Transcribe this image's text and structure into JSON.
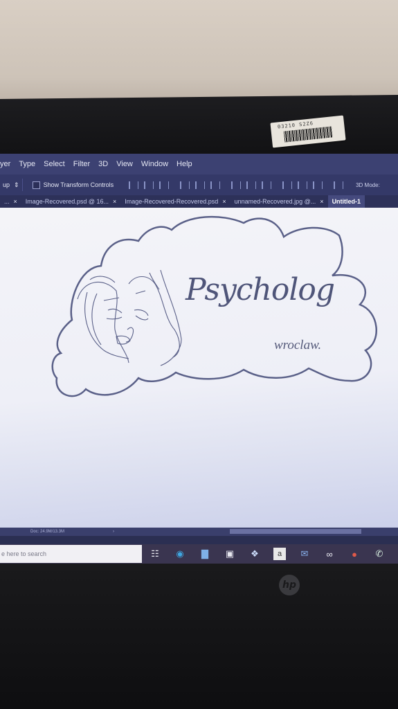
{
  "menu": [
    "yer",
    "Type",
    "Select",
    "Filter",
    "3D",
    "View",
    "Window",
    "Help"
  ],
  "options": {
    "select_value": "up",
    "select_arrow": "⇕",
    "show_transform_controls": "Show Transform Controls",
    "mode_3d": "3D Mode:"
  },
  "tabs": [
    {
      "label": "...",
      "close": "×"
    },
    {
      "label": "Image-Recovered.psd @ 16...",
      "close": "×"
    },
    {
      "label": "Image-Recovered-Recovered.psd",
      "close": "×"
    },
    {
      "label": "unnamed-Recovered.jpg @...",
      "close": "×"
    },
    {
      "label": "Untitled-1",
      "close": ""
    }
  ],
  "logo": {
    "title": "Psycholog",
    "subtitle": "wroclaw."
  },
  "status": {
    "doc": "Doc: 24.9M/13.3M",
    "arrow": "›"
  },
  "taskbar": {
    "search_placeholder": "e here to search",
    "icons": [
      "task-view-icon",
      "edge-icon",
      "photos-icon",
      "store-icon",
      "dropbox-icon",
      "amazon-icon",
      "mail-icon",
      "infinity-icon",
      "chrome-icon",
      "whatsapp-icon"
    ]
  },
  "sticker": {
    "text": "03210 S2Z6"
  },
  "brand": {
    "logo": "hp"
  },
  "colors": {
    "menubar": "#3c4172",
    "canvas": "#f4f4f8",
    "logo_stroke": "#5a6088"
  }
}
